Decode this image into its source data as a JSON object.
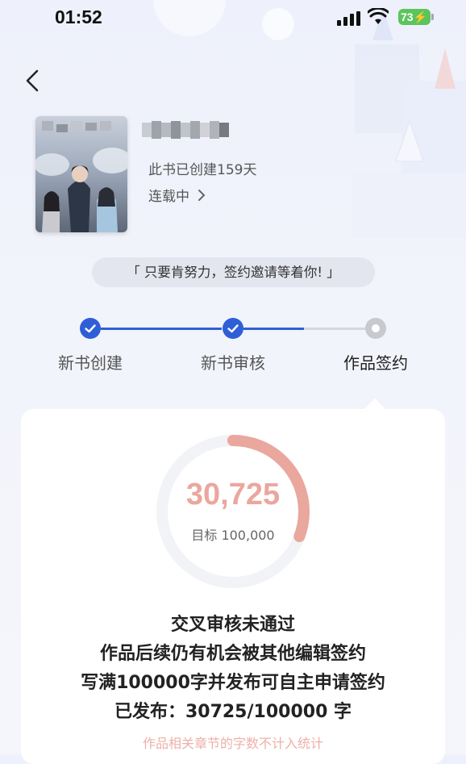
{
  "status_bar": {
    "time": "01:52",
    "battery": "73"
  },
  "book": {
    "created_text": "此书已创建159天",
    "status_text": "连载中"
  },
  "quote": "「 只要肯努力，签约邀请等着你! 」",
  "steps": [
    {
      "label": "新书创建",
      "state": "done"
    },
    {
      "label": "新书审核",
      "state": "done"
    },
    {
      "label": "作品签约",
      "state": "pending"
    }
  ],
  "progress": {
    "value_text": "30,725",
    "target_text": "目标 100,000",
    "value": 30725,
    "target": 100000
  },
  "messages": {
    "line1": "交叉审核未通过",
    "line2": "作品后续仍有机会被其他编辑签约",
    "line3": "写满100000字并发布可自主申请签约",
    "line4": "已发布：30725/100000 字",
    "note": "作品相关章节的字数不计入统计"
  },
  "colors": {
    "accent_blue": "#2f5fd6",
    "progress_pink": "#eaa79e",
    "note_pink": "#eeb0a8"
  }
}
